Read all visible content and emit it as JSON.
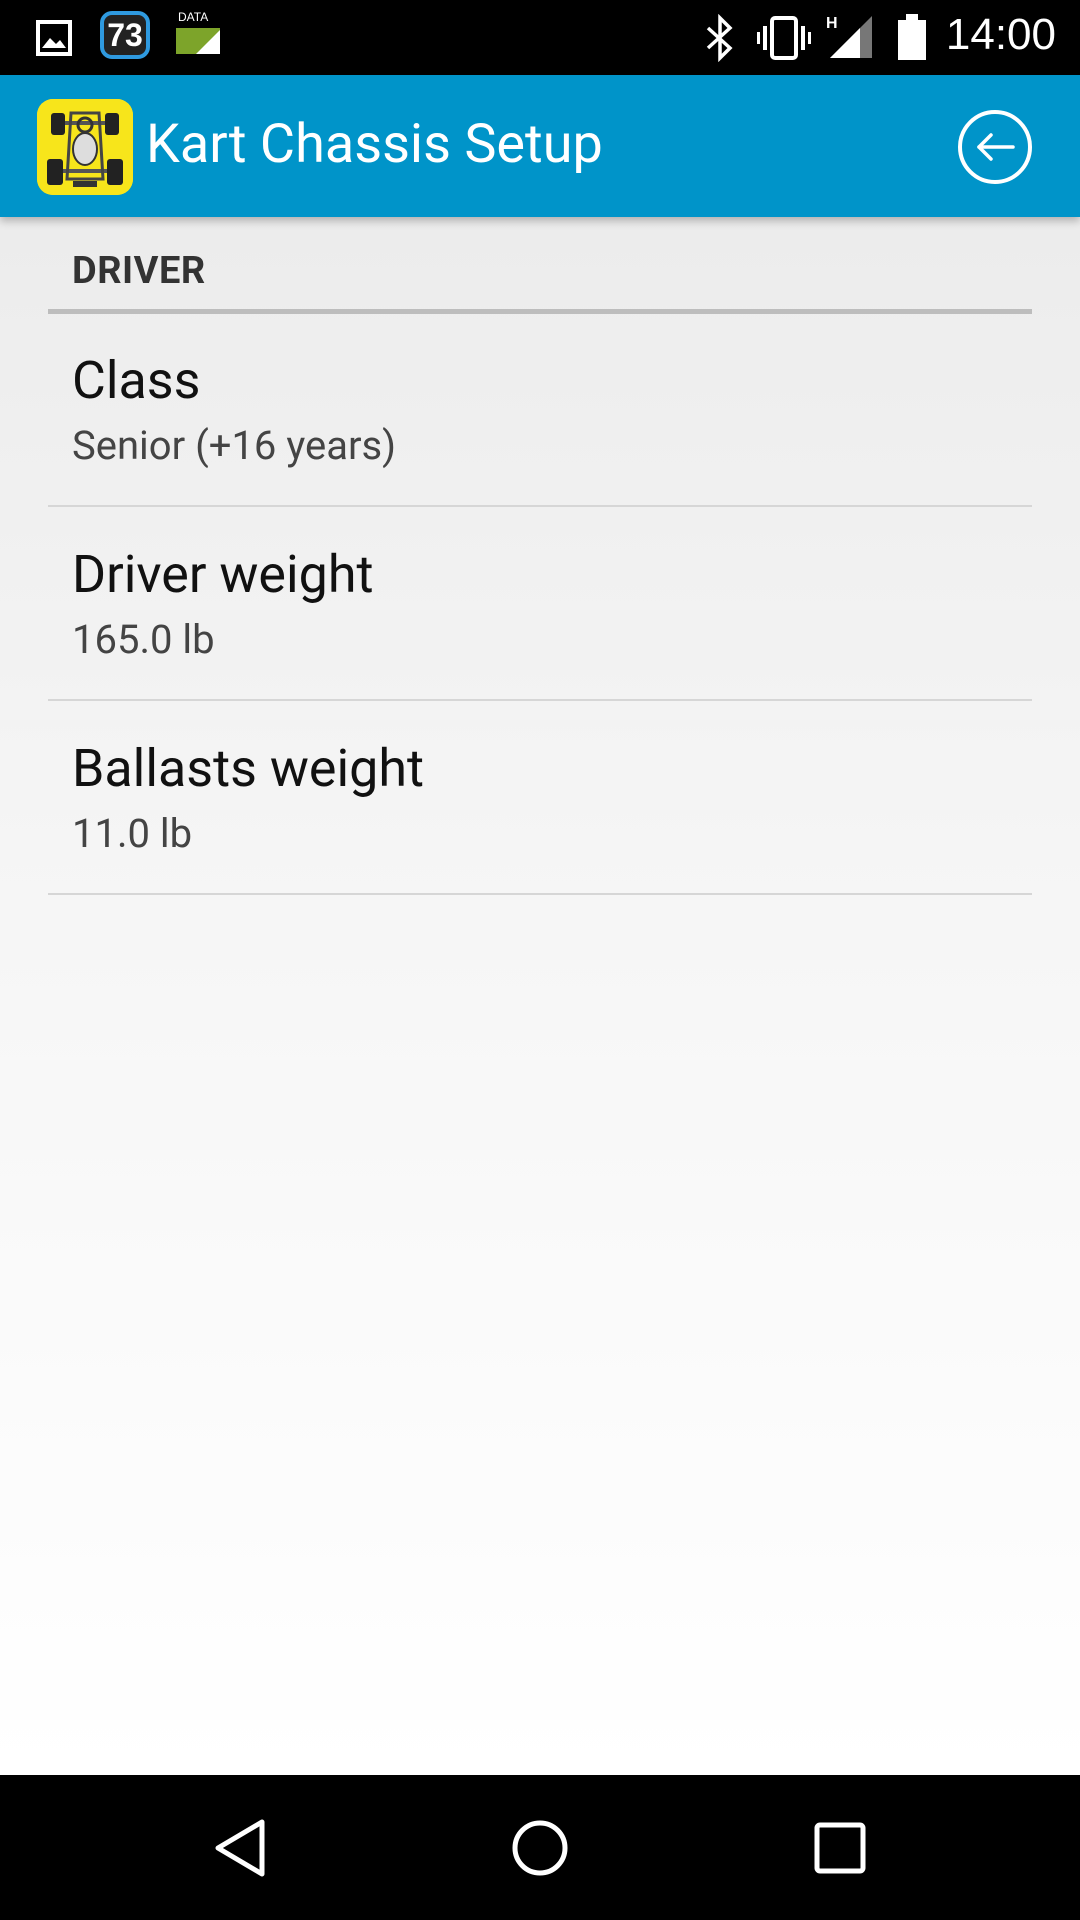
{
  "status_bar": {
    "time": "14:00",
    "notification_badge": "73",
    "data_label": "DATA",
    "network_type": "H",
    "icons": [
      "image-icon",
      "notification-73-icon",
      "data-icon",
      "bluetooth-icon",
      "vibrate-icon",
      "signal-icon",
      "battery-icon"
    ]
  },
  "app_bar": {
    "title": "Kart Chassis Setup",
    "background_color": "#0094c9",
    "logo_color": "#f7e51b",
    "back_icon": "back-arrow-circle-icon"
  },
  "section": {
    "header": "DRIVER"
  },
  "preferences": [
    {
      "title": "Class",
      "summary": "Senior (+16 years)"
    },
    {
      "title": "Driver weight",
      "summary": "165.0 lb"
    },
    {
      "title": "Ballasts weight",
      "summary": "11.0 lb"
    }
  ],
  "nav_bar": {
    "buttons": [
      "back-triangle-icon",
      "home-circle-icon",
      "recents-square-icon"
    ]
  }
}
